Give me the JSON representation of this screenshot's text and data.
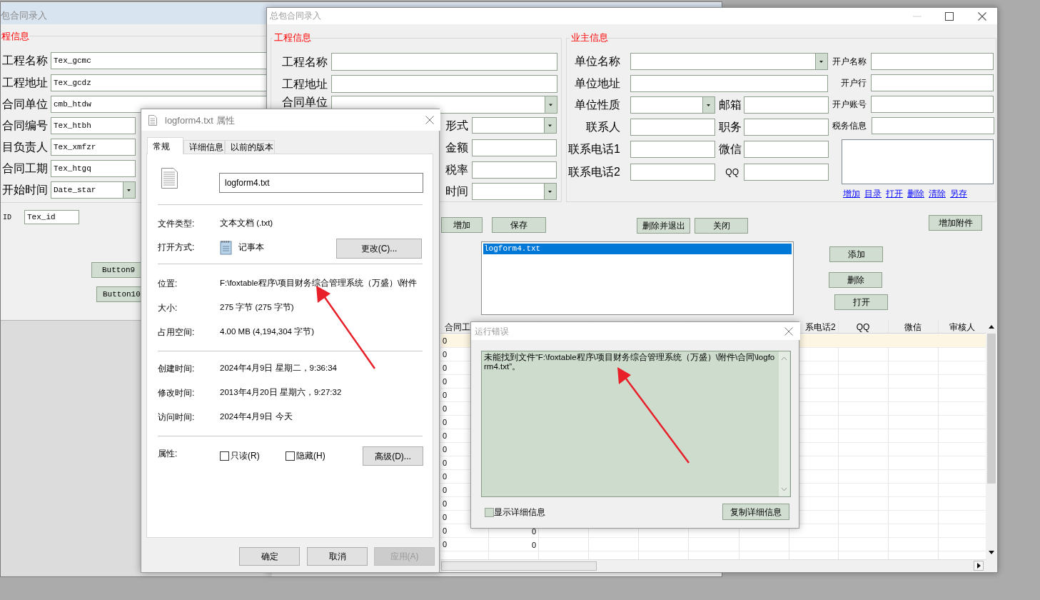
{
  "back_window": {
    "title": "包合同录入",
    "group_title": "程信息",
    "fields": [
      {
        "label": "工程名称",
        "value": "Tex_gcmc",
        "kind": "text"
      },
      {
        "label": "工程地址",
        "value": "Tex_gcdz",
        "kind": "text"
      },
      {
        "label": "合同单位",
        "value": "cmb_htdw",
        "kind": "text"
      },
      {
        "label": "合同编号",
        "value": "Tex_htbh",
        "kind": "text"
      },
      {
        "label": "目负责人",
        "value": "Tex_xmfzr",
        "kind": "text"
      },
      {
        "label": "合同工期",
        "value": "Tex_htgq",
        "kind": "text"
      },
      {
        "label": "开始时间",
        "value": "Date_star",
        "kind": "combo"
      }
    ],
    "id_field": {
      "label": "ID",
      "value": "Tex_id"
    },
    "buttons": [
      "Button9",
      "Button10"
    ]
  },
  "main_window": {
    "title": "总包合同录入",
    "project_group": {
      "title": "工程信息",
      "fields": [
        {
          "label": "工程名称",
          "kind": "text"
        },
        {
          "label": "工程地址",
          "kind": "text"
        },
        {
          "label": "合同单位",
          "kind": "combo"
        },
        {
          "label": "形式",
          "kind": "combo"
        },
        {
          "label": "金额",
          "kind": "text"
        },
        {
          "label": "税率",
          "kind": "text"
        },
        {
          "label": "时间",
          "kind": "combo"
        }
      ]
    },
    "owner_group": {
      "title": "业主信息",
      "fields": [
        {
          "label": "单位名称",
          "kind": "combo"
        },
        {
          "label": "开户名称",
          "kind": "text"
        },
        {
          "label": "单位地址",
          "kind": "text"
        },
        {
          "label": "开户行",
          "kind": "text"
        },
        {
          "label": "单位性质",
          "kind": "combo"
        },
        {
          "label": "邮箱",
          "kind": "text"
        },
        {
          "label": "开户账号",
          "kind": "text"
        },
        {
          "label": "联系人",
          "kind": "text"
        },
        {
          "label": "职务",
          "kind": "text"
        },
        {
          "label": "税务信息",
          "kind": "text"
        },
        {
          "label": "联系电话1",
          "kind": "text"
        },
        {
          "label": "微信",
          "kind": "text"
        },
        {
          "label": "联系电话2",
          "kind": "text"
        },
        {
          "label": "QQ",
          "kind": "text"
        }
      ],
      "links": [
        "增加",
        "目录",
        "打开",
        "删除",
        "清除",
        "另存"
      ]
    },
    "buttons": [
      "增加",
      "保存",
      "删除并退出",
      "关闭",
      "增加附件",
      "添加",
      "删除",
      "打开"
    ],
    "file_list": [
      {
        "text": "logform4.txt",
        "selected": true
      }
    ],
    "grid": {
      "columns": [
        "合同工",
        "系电话2",
        "QQ",
        "微信",
        "审核人"
      ],
      "rows": [
        {
          "cells": [
            "0"
          ]
        },
        {
          "cells": [
            "0"
          ]
        },
        {
          "cells": [
            "0"
          ]
        },
        {
          "cells": [
            "0"
          ]
        },
        {
          "cells": [
            "0"
          ]
        },
        {
          "cells": [
            "0"
          ]
        },
        {
          "cells": [
            "0"
          ]
        },
        {
          "cells": [
            "0"
          ]
        },
        {
          "cells": [
            "0"
          ]
        },
        {
          "cells": [
            "0"
          ]
        },
        {
          "cells": [
            "0"
          ]
        },
        {
          "cells": [
            "0"
          ]
        },
        {
          "cells": [
            "0"
          ]
        },
        {
          "cells": [
            "0"
          ]
        },
        {
          "cells": [
            "0",
            "0"
          ]
        },
        {
          "cells": [
            "0",
            "0"
          ]
        }
      ]
    }
  },
  "properties_dialog": {
    "title": "logform4.txt 属性",
    "tabs": [
      {
        "label": "常规",
        "selected": true
      },
      {
        "label": "详细信息",
        "selected": false
      },
      {
        "label": "以前的版本",
        "selected": false
      }
    ],
    "file_name": "logform4.txt",
    "rows": [
      {
        "label": "文件类型:",
        "value": "文本文档 (.txt)",
        "kind": "text"
      },
      {
        "label": "打开方式:",
        "value": "记事本",
        "kind": "app"
      },
      {
        "label": "位置:",
        "value": "F:\\foxtable程序\\项目财务综合管理系统（万盛）\\附件",
        "kind": "text"
      },
      {
        "label": "大小:",
        "value": "275 字节 (275 字节)",
        "kind": "text"
      },
      {
        "label": "占用空间:",
        "value": "4.00 MB (4,194,304 字节)",
        "kind": "text"
      },
      {
        "label": "创建时间:",
        "value": "2024年4月9日 星期二，9:36:34",
        "kind": "text"
      },
      {
        "label": "修改时间:",
        "value": "2013年4月20日 星期六，9:27:32",
        "kind": "text"
      },
      {
        "label": "访问时间:",
        "value": "2024年4月9日 今天",
        "kind": "text"
      }
    ],
    "change_button": "更改(C)...",
    "attributes": {
      "label": "属性:",
      "options": [
        {
          "label": "只读(R)",
          "checked": false
        },
        {
          "label": "隐藏(H)",
          "checked": false
        }
      ],
      "advanced_button": "高级(D)..."
    },
    "buttons": [
      {
        "label": "确定",
        "disabled": false
      },
      {
        "label": "取消",
        "disabled": false
      },
      {
        "label": "应用(A)",
        "disabled": true
      }
    ]
  },
  "error_dialog": {
    "title": "运行错误",
    "message": "未能找到文件“F:\\foxtable程序\\项目财务综合管理系统（万盛）\\附件\\合同\\logform4.txt”。",
    "show_details": {
      "label": "显示详细信息",
      "checked": false
    },
    "copy_button": "复制详细信息"
  }
}
